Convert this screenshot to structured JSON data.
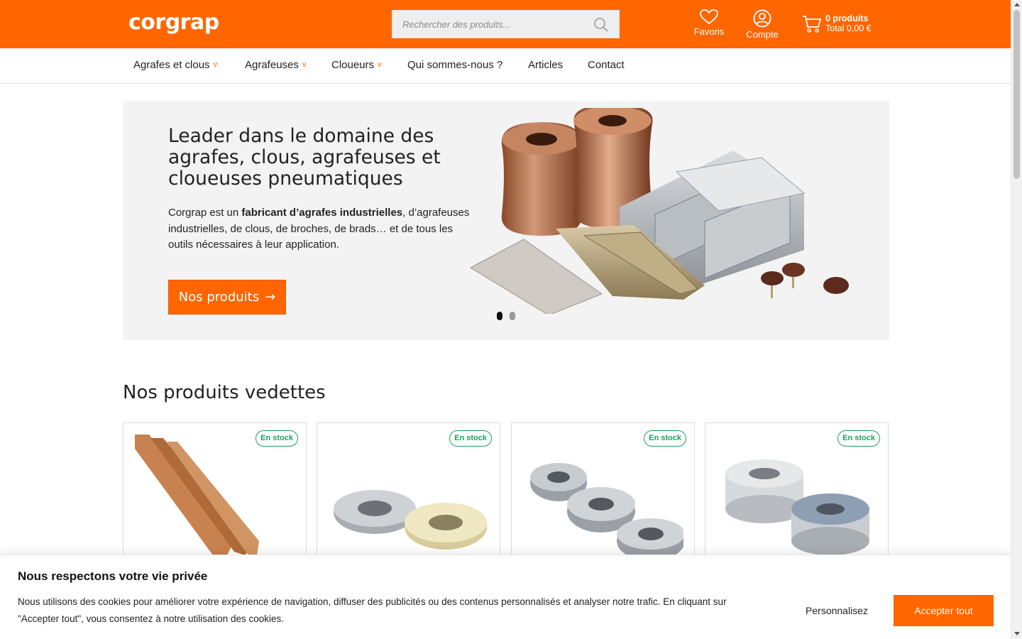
{
  "header": {
    "logo": "corgrap",
    "search_placeholder": "Rechercher des produits...",
    "favorites_label": "Favoris",
    "account_label": "Compte",
    "cart_count": "0 produits",
    "cart_total": "Total 0,00 €",
    "icons": [
      "heart-icon",
      "user-icon",
      "cart-icon",
      "search-icon"
    ]
  },
  "nav": {
    "items": [
      {
        "label": "Agrafes et clous",
        "dropdown": "v"
      },
      {
        "label": "Agrafeuses",
        "dropdown": "v"
      },
      {
        "label": "Cloueurs",
        "dropdown": "v"
      },
      {
        "label": "Qui sommes-nous ?"
      },
      {
        "label": "Articles"
      },
      {
        "label": "Contact"
      }
    ]
  },
  "hero": {
    "title": "Leader dans le domaine des agrafes, clous, agrafeuses et cloueuses pneumatiques",
    "text_before": "Corgrap est un ",
    "text_bold": "fabricant d’agrafes industrielles",
    "text_after": ", d’agrafeuses industrielles, de clous, de broches, de brads… et de tous les outils nécessaires à leur application.",
    "cta_label": "Nos produits",
    "cta_arrow": "→",
    "slides": 2,
    "active_slide": 1
  },
  "featured": {
    "title": "Nos produits vedettes",
    "products": [
      {
        "badge": "En stock"
      },
      {
        "badge": "En stock"
      },
      {
        "badge": "En stock"
      },
      {
        "badge": "En stock"
      }
    ]
  },
  "cookie": {
    "title": "Nous respectons votre vie privée",
    "text": "Nous utilisons des cookies pour améliorer votre expérience de navigation, diffuser des publicités ou des contenus personnalisés et analyser notre trafic. En cliquant sur \"Accepter tout\", vous consentez à notre utilisation des cookies.",
    "customize_label": "Personnalisez",
    "accept_label": "Accepter tout"
  },
  "colors": {
    "brand": "#ff6600",
    "stock_badge": "#1aa35a"
  }
}
